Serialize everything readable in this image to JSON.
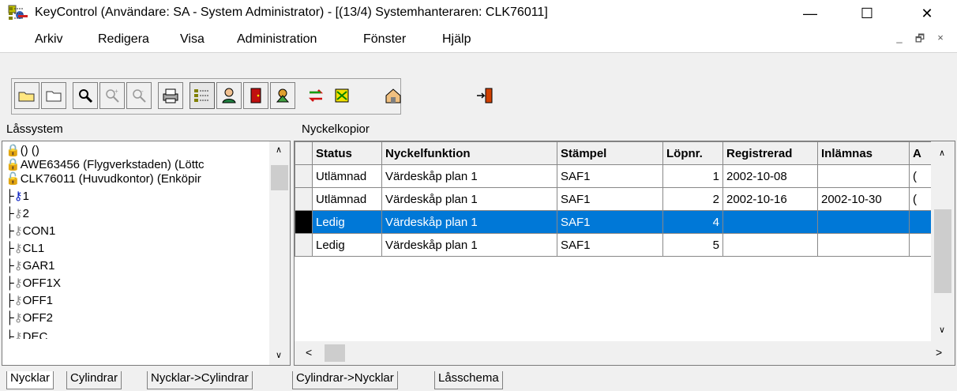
{
  "window": {
    "title": "KeyControl   (Användare: SA - System Administrator) - [(13/4) Systemhanteraren: CLK76011]",
    "minimize": "—",
    "maximize": "☐",
    "close": "✕"
  },
  "menu": {
    "items": [
      "Arkiv",
      "Redigera",
      "Visa",
      "Administration",
      "Fönster",
      "Hjälp"
    ],
    "mdi": [
      "_",
      "🗗",
      "×"
    ]
  },
  "panels": {
    "left_label": "Låssystem",
    "right_label": "Nyckelkopior"
  },
  "tree": {
    "lines": [
      "() ()",
      "AWE63456 (Flygverkstaden) (Löttc",
      "CLK76011 (Huvudkontor) (Enköpir",
      "1",
      "2",
      "CON1",
      "CL1",
      "GAR1",
      "OFF1X",
      "OFF1",
      "OFF2",
      "DEC"
    ]
  },
  "grid": {
    "columns": [
      "Status",
      "Nyckelfunktion",
      "Stämpel",
      "Löpnr.",
      "Registrerad",
      "Inlämnas",
      "A"
    ],
    "rows": [
      {
        "status": "Utlämnad",
        "funktion": "Värdeskåp plan 1",
        "stampel": "SAF1",
        "lopnr": "1",
        "registrerad": "2002-10-08",
        "inlamnas": "",
        "a": "("
      },
      {
        "status": "Utlämnad",
        "funktion": "Värdeskåp plan 1",
        "stampel": "SAF1",
        "lopnr": "2",
        "registrerad": "2002-10-16",
        "inlamnas": "2002-10-30",
        "a": "("
      },
      {
        "status": "Ledig",
        "funktion": "Värdeskåp plan 1",
        "stampel": "SAF1",
        "lopnr": "4",
        "registrerad": "",
        "inlamnas": "",
        "a": ""
      },
      {
        "status": "Ledig",
        "funktion": "Värdeskåp plan 1",
        "stampel": "SAF1",
        "lopnr": "5",
        "registrerad": "",
        "inlamnas": "",
        "a": ""
      }
    ],
    "selected_row": 2
  },
  "tabs": [
    "Nycklar",
    "Cylindrar",
    "Nycklar->Cylindrar",
    "Cylindrar->Nycklar",
    "Låsschema"
  ],
  "colors": {
    "selection": "#0078d7",
    "window_bg": "#f0f0f0"
  }
}
